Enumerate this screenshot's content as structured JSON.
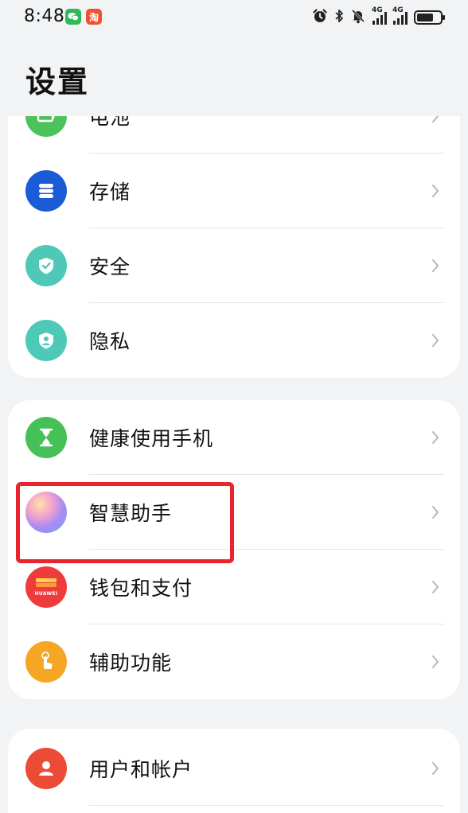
{
  "status_bar": {
    "time": "8:48",
    "taobao_glyph": "淘",
    "signal_1_tag": "4G",
    "signal_2_tag": "4G",
    "battery_level": 0.7
  },
  "page": {
    "title": "设置"
  },
  "groups": [
    {
      "items": [
        {
          "label": "电池",
          "icon": "battery-icon",
          "color": "#4cc35a"
        },
        {
          "label": "存储",
          "icon": "storage-icon",
          "color": "#1a5bd6"
        },
        {
          "label": "安全",
          "icon": "security-shield-icon",
          "color": "#4fc9b7"
        },
        {
          "label": "隐私",
          "icon": "privacy-icon",
          "color": "#4fc9b7"
        }
      ]
    },
    {
      "items": [
        {
          "label": "健康使用手机",
          "icon": "hourglass-icon",
          "color": "#45c157"
        },
        {
          "label": "智慧助手",
          "icon": "smart-assistant-icon",
          "color": "#b58cf0"
        },
        {
          "label": "钱包和支付",
          "icon": "wallet-icon",
          "color": "#ee3b3b",
          "icon_text": "HUAWEI"
        },
        {
          "label": "辅助功能",
          "icon": "accessibility-hand-icon",
          "color": "#f5a623"
        }
      ]
    },
    {
      "items": [
        {
          "label": "用户和帐户",
          "icon": "user-icon",
          "color": "#ec4b36"
        }
      ]
    }
  ],
  "highlight_color": "#e8242d"
}
